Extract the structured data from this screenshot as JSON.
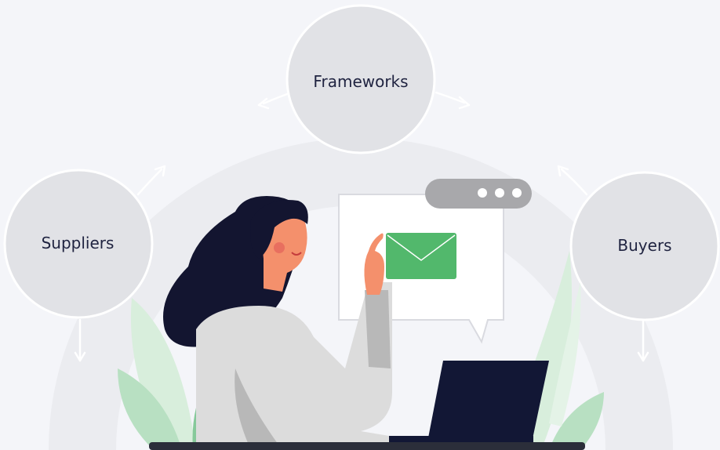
{
  "diagram": {
    "nodes": [
      {
        "id": "frameworks",
        "label": "Frameworks"
      },
      {
        "id": "suppliers",
        "label": "Suppliers"
      },
      {
        "id": "buyers",
        "label": "Buyers"
      }
    ]
  },
  "colors": {
    "background": "#f4f5f9",
    "ring": "#ebecf0",
    "node_fill": "#e1e2e6",
    "node_stroke": "#ffffff",
    "arrow": "#ffffff",
    "leaf_light": "#d8eedc",
    "leaf_mid": "#b8e0c2",
    "leaf_dark": "#86c99a",
    "envelope": "#52b86c",
    "chat_pill": "#a8a8ab",
    "laptop": "#121735",
    "sweater": "#dcdcdc",
    "sweater_shadow": "#b8b8b8",
    "skin": "#f4906c",
    "hair": "#131530"
  },
  "icons": [
    "envelope-icon",
    "more-dots-icon"
  ]
}
